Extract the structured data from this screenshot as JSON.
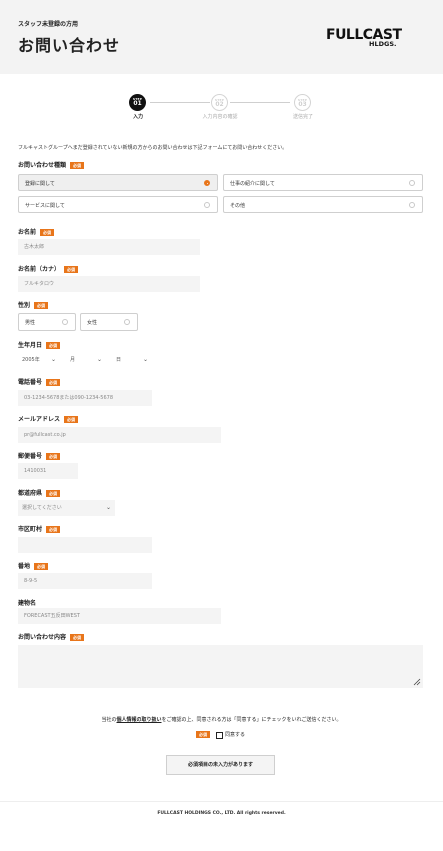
{
  "header": {
    "subtitle": "スタッフ未登録の方用",
    "title": "お問い合わせ",
    "logo_line1": "FULLCAST",
    "logo_line2": "HLDGS."
  },
  "stepper": {
    "steps": [
      {
        "tag": "STEP",
        "num": "01",
        "label": "入力",
        "active": true
      },
      {
        "tag": "STEP",
        "num": "02",
        "label": "入力内容の確認",
        "active": false
      },
      {
        "tag": "STEP",
        "num": "03",
        "label": "送信完了",
        "active": false
      }
    ]
  },
  "intro": "フルキャストグループへまだ登録されていない新規の方からのお問い合わせは下記フォームにてお問い合わせください。",
  "required_label": "必須",
  "form": {
    "inquiry_type": {
      "label": "お問い合わせ種類",
      "options": [
        "登録に関して",
        "仕事の紹介に関して",
        "サービスに関して",
        "その他"
      ],
      "selected": "登録に関して"
    },
    "name": {
      "label": "お名前",
      "placeholder": "古木太郎"
    },
    "kana": {
      "label": "お名前（カナ）",
      "placeholder": "フルキタロウ"
    },
    "gender": {
      "label": "性別",
      "options": [
        "男性",
        "女性"
      ]
    },
    "birthdate": {
      "label": "生年月日",
      "year": "2005年",
      "month": "月",
      "day": "日"
    },
    "phone": {
      "label": "電話番号",
      "placeholder": "03-1234-5678または090-1234-5678"
    },
    "email": {
      "label": "メールアドレス",
      "placeholder": "pr@fullcast.co.jp"
    },
    "postal": {
      "label": "郵便番号",
      "placeholder": "1410031"
    },
    "prefecture": {
      "label": "都道府県",
      "placeholder": "選択してください"
    },
    "city": {
      "label": "市区町村",
      "placeholder": ""
    },
    "street": {
      "label": "番地",
      "placeholder": "8-9-5"
    },
    "building": {
      "label": "建物名",
      "placeholder": "FORECAST五反田WEST"
    },
    "content": {
      "label": "お問い合わせ内容"
    }
  },
  "consent": {
    "prefix": "当社の",
    "link": "個人情報の取り扱い",
    "suffix": "をご確認の上、同意される方は「同意する」にチェックをいれご送信ください。",
    "agree_label": "同意する"
  },
  "submit_label": "必須項目の未入力があります",
  "footer": "FULLCAST HOLDINGS CO., LTD. All rights reserved.",
  "colors": {
    "accent": "#e8751a",
    "header_bg": "#f3f3f3",
    "input_bg": "#f4f4f4"
  }
}
